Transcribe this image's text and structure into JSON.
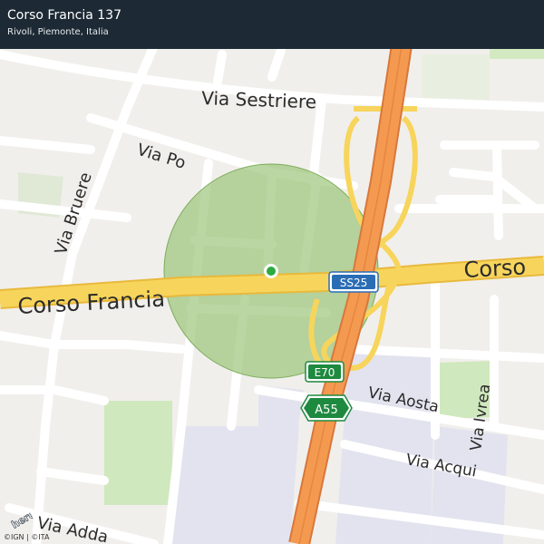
{
  "header": {
    "title": "Corso Francia 137",
    "subtitle": "Rivoli, Piemonte, Italia"
  },
  "map": {
    "street_labels": {
      "via_sestriere": "Via Sestriere",
      "via_po": "Via Po",
      "via_bruere": "Via Bruere",
      "corso_francia": "Corso Francia",
      "corso_right": "Corso",
      "via_aosta": "Via Aosta",
      "via_ivrea": "Via Ivrea",
      "via_acqui": "Via Acqui",
      "via_adda": "Via Adda"
    },
    "road_shields": {
      "ss25": "SS25",
      "e70": "E70",
      "a55": "A55"
    },
    "logo_text": "here",
    "attribution": "©IGN | ©ITA",
    "colors": {
      "background": "#f1efec",
      "header": "#1d2a35",
      "main_road": "#f7d55c",
      "highway": "#f39a50",
      "location_circle": "#8fbf6a",
      "location_dot": "#2eaa3f",
      "park": "#cfe8bd",
      "industrial": "#e3e3ef"
    }
  }
}
